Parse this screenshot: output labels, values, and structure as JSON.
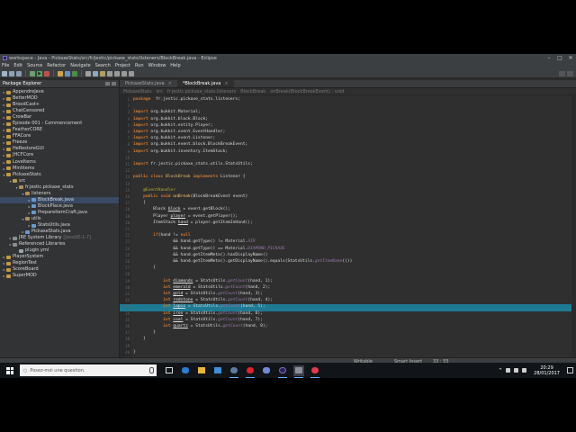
{
  "window": {
    "title": "workspace - Java - PickaxeStats/src/fr/jestic/pickaxe_stats/listeners/BlockBreak.java - Eclipse"
  },
  "menu": [
    "File",
    "Edit",
    "Source",
    "Refactor",
    "Navigate",
    "Search",
    "Project",
    "Run",
    "Window",
    "Help"
  ],
  "package_explorer": {
    "title": "Package Explorer",
    "items": [
      {
        "label": "AppendreJeve",
        "level": 0,
        "icon": "proj",
        "twisty": "▸"
      },
      {
        "label": "BetterMOD",
        "level": 0,
        "icon": "proj",
        "twisty": "▸"
      },
      {
        "label": "BroodCast+",
        "level": 0,
        "icon": "proj",
        "twisty": "▸"
      },
      {
        "label": "ChatCensored",
        "level": 0,
        "icon": "proj",
        "twisty": "▸"
      },
      {
        "label": "CrowBar",
        "level": 0,
        "icon": "proj",
        "twisty": "▸"
      },
      {
        "label": "Episode 001 - Commencement",
        "level": 0,
        "icon": "proj",
        "twisty": "▸"
      },
      {
        "label": "FeatherCORE",
        "level": 0,
        "icon": "proj",
        "twisty": "▸"
      },
      {
        "label": "FFACore",
        "level": 0,
        "icon": "proj",
        "twisty": "▸"
      },
      {
        "label": "Freeze",
        "level": 0,
        "icon": "proj",
        "twisty": "▸"
      },
      {
        "label": "HeRestoreGUI",
        "level": 0,
        "icon": "proj",
        "twisty": "▸"
      },
      {
        "label": "JHCFCore",
        "level": 0,
        "icon": "proj",
        "twisty": "▸"
      },
      {
        "label": "LoveItems",
        "level": 0,
        "icon": "proj",
        "twisty": "▸"
      },
      {
        "label": "MiniItems",
        "level": 0,
        "icon": "proj",
        "twisty": "▸"
      },
      {
        "label": "PickaxeStats",
        "level": 0,
        "icon": "proj",
        "twisty": "▾"
      },
      {
        "label": "src",
        "level": 1,
        "icon": "src",
        "twisty": "▾"
      },
      {
        "label": "fr.jestic.pickaxe_stats",
        "level": 2,
        "icon": "pkg",
        "twisty": "▾"
      },
      {
        "label": "listeners",
        "level": 3,
        "icon": "pkg",
        "twisty": "▾"
      },
      {
        "label": "BlockBreak.java",
        "level": 4,
        "icon": "java",
        "twisty": "▸",
        "selected": true
      },
      {
        "label": "BlockPlace.java",
        "level": 4,
        "icon": "java",
        "twisty": "▸"
      },
      {
        "label": "PrepareItemCraft.java",
        "level": 4,
        "icon": "java",
        "twisty": "▸"
      },
      {
        "label": "utils",
        "level": 3,
        "icon": "pkg",
        "twisty": "▾"
      },
      {
        "label": "StatsUtils.java",
        "level": 4,
        "icon": "java",
        "twisty": "▸"
      },
      {
        "label": "PickaxeStats.java",
        "level": 3,
        "icon": "java",
        "twisty": "▸"
      },
      {
        "label": "JRE System Library",
        "level": 1,
        "icon": "lib",
        "twisty": "▸",
        "suffix": "[JavaSE-1.7]"
      },
      {
        "label": "Referenced Libraries",
        "level": 1,
        "icon": "lib",
        "twisty": "▸"
      },
      {
        "label": "plugin.yml",
        "level": 2,
        "icon": "yml",
        "twisty": ""
      },
      {
        "label": "PlayerSystem",
        "level": 0,
        "icon": "proj",
        "twisty": "▸"
      },
      {
        "label": "RegionTest",
        "level": 0,
        "icon": "proj",
        "twisty": "▸"
      },
      {
        "label": "ScoreBoard",
        "level": 0,
        "icon": "proj",
        "twisty": "▸"
      },
      {
        "label": "SuperMOD",
        "level": 0,
        "icon": "proj",
        "twisty": "▸"
      }
    ]
  },
  "editor": {
    "tabs": [
      {
        "label": "PickaxeStats.java",
        "active": false
      },
      {
        "label": "*BlockBreak.java",
        "active": true
      }
    ],
    "breadcrumb": [
      "PickaxeStats",
      "src",
      "fr.jestic.pickaxe_stats.listeners",
      "BlockBreak",
      "onBreak(BlockBreakEvent) : void"
    ],
    "highlight_line": 33,
    "lines": [
      [
        [
          "kw",
          "package"
        ],
        [
          "",
          "  fr.jestic.pickaxe_stats.listeners;"
        ]
      ],
      [],
      [
        [
          "kw",
          "import"
        ],
        [
          "",
          " org.bukkit.Material;"
        ]
      ],
      [
        [
          "kw",
          "import"
        ],
        [
          "",
          " org.bukkit.block.Block;"
        ]
      ],
      [
        [
          "kw",
          "import"
        ],
        [
          "",
          " org.bukkit.entity.Player;"
        ]
      ],
      [
        [
          "kw",
          "import"
        ],
        [
          "",
          " org.bukkit.event.EventHandler;"
        ]
      ],
      [
        [
          "kw",
          "import"
        ],
        [
          "",
          " org.bukkit.event.Listener;"
        ]
      ],
      [
        [
          "kw",
          "import"
        ],
        [
          "",
          " org.bukkit.event.block.BlockBreakEvent;"
        ]
      ],
      [
        [
          "kw",
          "import"
        ],
        [
          "",
          " org.bukkit.inventory.ItemStack;"
        ]
      ],
      [],
      [
        [
          "kw",
          "import"
        ],
        [
          "",
          " fr.jestic.pickaxe_stats.utils.StatsUtils;"
        ]
      ],
      [],
      [
        [
          "kw",
          "public class"
        ],
        [
          "",
          " "
        ],
        [
          "ty",
          "BlockBreak"
        ],
        [
          "",
          " "
        ],
        [
          "kw",
          "implements"
        ],
        [
          "",
          " Listener {"
        ]
      ],
      [],
      [
        [
          "",
          "    "
        ],
        [
          "ann",
          "@EventHandler"
        ]
      ],
      [
        [
          "",
          "    "
        ],
        [
          "kw",
          "public void"
        ],
        [
          "",
          " "
        ],
        [
          "mth",
          "onBreak"
        ],
        [
          "",
          "(BlockBreakEvent event)"
        ]
      ],
      [
        [
          "",
          "    {"
        ]
      ],
      [
        [
          "",
          "        Block "
        ],
        [
          "var",
          "block"
        ],
        [
          "",
          " = event.getBlock();"
        ]
      ],
      [
        [
          "",
          "        Player "
        ],
        [
          "var",
          "player"
        ],
        [
          "",
          " = event.getPlayer();"
        ]
      ],
      [
        [
          "",
          "        ItemStack "
        ],
        [
          "var",
          "hand"
        ],
        [
          "",
          " = player.getItemInHand();"
        ]
      ],
      [],
      [
        [
          "",
          "        "
        ],
        [
          "kw",
          "if"
        ],
        [
          "",
          "(hand != "
        ],
        [
          "kw",
          "null"
        ]
      ],
      [
        [
          "",
          "                && hand.getType() != Material."
        ],
        [
          "fld",
          "AIR"
        ]
      ],
      [
        [
          "",
          "                && hand.getType() == Material."
        ],
        [
          "fld",
          "DIAMOND_PICKAXE"
        ]
      ],
      [
        [
          "",
          "                && hand.getItemMeta().hasDisplayName()"
        ]
      ],
      [
        [
          "",
          "                && hand.getItemMeta().getDisplayName().equals(StatsUtils."
        ],
        [
          "fld",
          "getItemName"
        ],
        [
          "",
          "()))"
        ]
      ],
      [
        [
          "",
          "        {"
        ]
      ],
      [],
      [
        [
          "",
          "            "
        ],
        [
          "kw",
          "int"
        ],
        [
          "",
          " "
        ],
        [
          "var",
          "diamonds"
        ],
        [
          "",
          " = StatsUtils."
        ],
        [
          "fld",
          "getCount"
        ],
        [
          "",
          "(hand, 1);"
        ]
      ],
      [
        [
          "",
          "            "
        ],
        [
          "kw",
          "int"
        ],
        [
          "",
          " "
        ],
        [
          "var",
          "emerald"
        ],
        [
          "",
          " = StatsUtils."
        ],
        [
          "fld",
          "getCount"
        ],
        [
          "",
          "(hand, 2);"
        ]
      ],
      [
        [
          "",
          "            "
        ],
        [
          "kw",
          "int"
        ],
        [
          "",
          " "
        ],
        [
          "var",
          "gold"
        ],
        [
          "",
          " = StatsUtils."
        ],
        [
          "fld",
          "getCount"
        ],
        [
          "",
          "(hand, 3);"
        ]
      ],
      [
        [
          "",
          "            "
        ],
        [
          "kw",
          "int"
        ],
        [
          "",
          " "
        ],
        [
          "var",
          "redstone"
        ],
        [
          "",
          " = StatsUtils."
        ],
        [
          "fld",
          "getCount"
        ],
        [
          "",
          "(hand, 4);"
        ]
      ],
      [
        [
          "",
          "            "
        ],
        [
          "kw",
          "int"
        ],
        [
          "",
          " "
        ],
        [
          "var",
          "lapis"
        ],
        [
          "",
          " = StatsUtils."
        ],
        [
          "fld",
          "getCount"
        ],
        [
          "",
          "(hand, 5);"
        ]
      ],
      [
        [
          "",
          "            "
        ],
        [
          "kw",
          "int"
        ],
        [
          "",
          " "
        ],
        [
          "var",
          "iron"
        ],
        [
          "",
          " = StatsUtils."
        ],
        [
          "fld",
          "getCount"
        ],
        [
          "",
          "(hand, 6);"
        ]
      ],
      [
        [
          "",
          "            "
        ],
        [
          "kw",
          "int"
        ],
        [
          "",
          " "
        ],
        [
          "var",
          "coal"
        ],
        [
          "",
          " = StatsUtils."
        ],
        [
          "fld",
          "getCount"
        ],
        [
          "",
          "(hand, 7);"
        ]
      ],
      [
        [
          "",
          "            "
        ],
        [
          "kw",
          "int"
        ],
        [
          "",
          " "
        ],
        [
          "var",
          "quartz"
        ],
        [
          "",
          " = StatsUtils."
        ],
        [
          "fld",
          "getCount"
        ],
        [
          "",
          "(hand, 8);"
        ]
      ],
      [
        [
          "",
          "        }"
        ]
      ],
      [
        [
          "",
          "    }"
        ]
      ],
      [],
      [
        [
          "",
          "}"
        ]
      ],
      []
    ]
  },
  "status": {
    "writable": "Writable",
    "insert": "Smart Insert",
    "position": "33 : 55"
  },
  "taskbar": {
    "search_placeholder": "Posez-moi une question.",
    "time": "20:29",
    "date": "28/01/2017"
  },
  "colors": {
    "accent": "#1e7a93",
    "editor_bg": "#2f2f2f",
    "selection": "#3a4a64"
  }
}
